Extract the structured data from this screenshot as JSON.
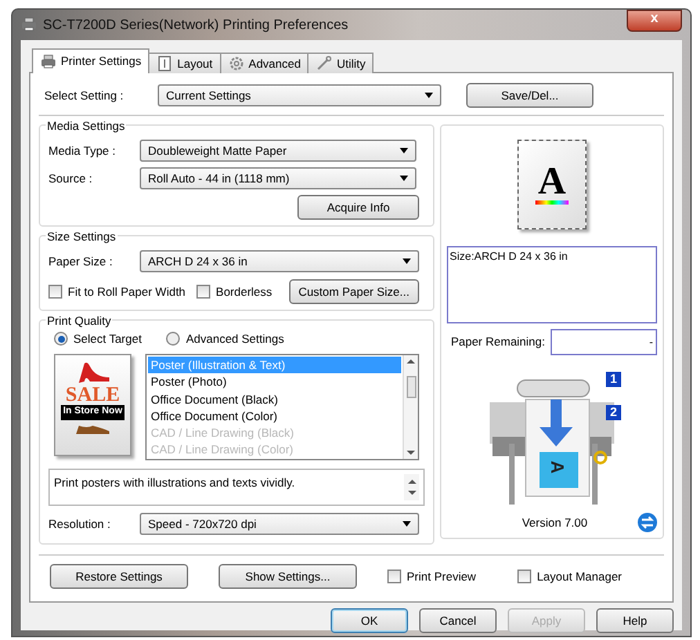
{
  "window": {
    "title": "SC-T7200D Series(Network) Printing Preferences",
    "close": "x"
  },
  "tabs": [
    {
      "label": "Printer Settings",
      "selected": true
    },
    {
      "label": "Layout",
      "selected": false
    },
    {
      "label": "Advanced",
      "selected": false
    },
    {
      "label": "Utility",
      "selected": false
    }
  ],
  "select_setting": {
    "label": "Select Setting :",
    "value": "Current Settings",
    "button": "Save/Del..."
  },
  "media_settings": {
    "title": "Media Settings",
    "fields": [
      {
        "label": "Media Type :",
        "value": "Doubleweight Matte Paper"
      },
      {
        "label": "Source :",
        "value": "Roll Auto - 44 in (1118 mm)"
      }
    ],
    "button": "Acquire Info"
  },
  "size_settings": {
    "title": "Size Settings",
    "paper_size": {
      "label": "Paper Size :",
      "value": "ARCH D 24 x 36 in"
    },
    "checkboxes": [
      {
        "label": "Fit to Roll Paper Width",
        "checked": false
      },
      {
        "label": "Borderless",
        "checked": false
      }
    ],
    "button": "Custom Paper Size..."
  },
  "print_quality": {
    "title": "Print Quality",
    "radios": [
      {
        "label": "Select Target",
        "selected": true
      },
      {
        "label": "Advanced Settings",
        "selected": false
      }
    ],
    "target_image": {
      "texts": [
        "SALE",
        "In Store Now"
      ]
    },
    "targets": [
      {
        "label": "Poster (Illustration & Text)",
        "selected": true,
        "disabled": false
      },
      {
        "label": "Poster (Photo)",
        "selected": false,
        "disabled": false
      },
      {
        "label": "Office Document (Black)",
        "selected": false,
        "disabled": false
      },
      {
        "label": "Office Document (Color)",
        "selected": false,
        "disabled": false
      },
      {
        "label": "CAD / Line Drawing (Black)",
        "selected": false,
        "disabled": true
      },
      {
        "label": "CAD / Line Drawing (Color)",
        "selected": false,
        "disabled": true
      }
    ],
    "description": "Print posters with illustrations and texts vividly.",
    "resolution": {
      "label": "Resolution :",
      "value": "Speed - 720x720 dpi"
    }
  },
  "preview": {
    "page_letter": "A",
    "size_text": "Size:ARCH D 24 x 36 in",
    "paper_remaining": {
      "label": "Paper Remaining:",
      "value": "-"
    },
    "printer_badges": [
      "1",
      "2"
    ],
    "printer_page_letter": "A",
    "version": "Version 7.00"
  },
  "bottom": {
    "buttons": [
      "Restore Settings",
      "Show Settings..."
    ],
    "checkboxes": [
      {
        "label": "Print Preview",
        "checked": false
      },
      {
        "label": "Layout Manager",
        "checked": false
      }
    ]
  },
  "dialog_buttons": [
    {
      "label": "OK",
      "disabled": false,
      "default": true
    },
    {
      "label": "Cancel",
      "disabled": false,
      "default": false
    },
    {
      "label": "Apply",
      "disabled": true,
      "default": false
    },
    {
      "label": "Help",
      "disabled": false,
      "default": false
    }
  ]
}
